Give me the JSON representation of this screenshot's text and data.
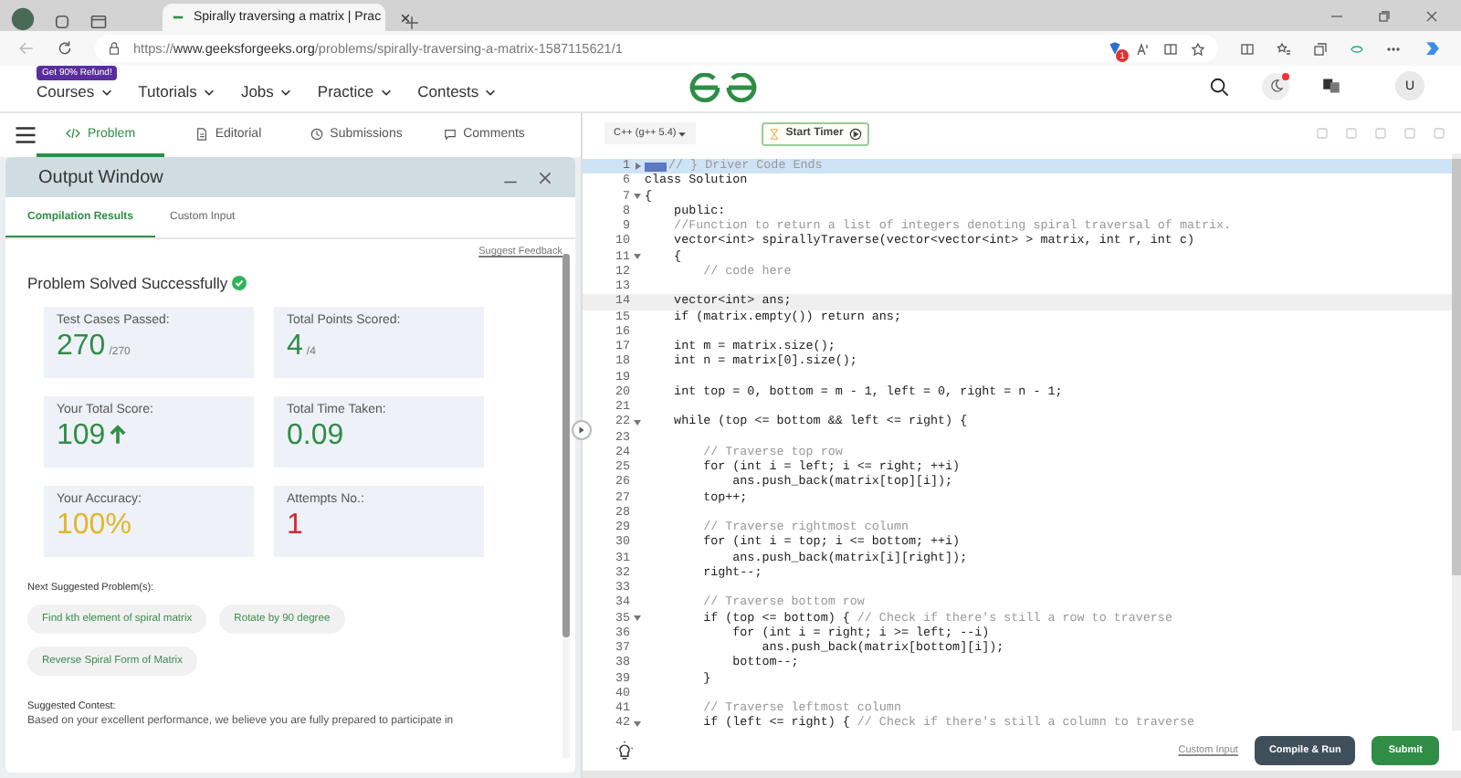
{
  "browser": {
    "tab_title": "Spirally traversing a matrix | Prac",
    "url": "https://**www.geeksforgeeks.org**/problems/spirally-traversing-a-matrix-1587115621/1",
    "extension_badge": "1"
  },
  "site_nav": {
    "promo_badge": "Get 90% Refund!",
    "menus": [
      "Courses",
      "Tutorials",
      "Jobs",
      "Practice",
      "Contests"
    ],
    "notification": true,
    "avatar": "U"
  },
  "problem_tabs": [
    {
      "label": "Problem",
      "selected": true
    },
    {
      "label": "Editorial",
      "selected": false
    },
    {
      "label": "Submissions",
      "selected": false
    },
    {
      "label": "Comments",
      "selected": false
    }
  ],
  "output_window": {
    "title": "Output Window",
    "tabs": [
      {
        "label": "Compilation Results",
        "selected": true
      },
      {
        "label": "Custom Input",
        "selected": false
      }
    ],
    "feedback_link": "Suggest Feedback",
    "status": "Problem Solved Successfully",
    "stats": [
      {
        "label": "Test Cases Passed:",
        "value": "270",
        "suffix": "/270",
        "color": "#2f8d46"
      },
      {
        "label": "Total Points Scored:",
        "value": "4",
        "suffix": "/4",
        "color": "#2f8d46"
      },
      {
        "label": "Your Total Score:",
        "value": "109",
        "trend_up": true,
        "color": "#2f8d46"
      },
      {
        "label": "Total Time Taken:",
        "value": "0.09",
        "color": "#2f8d46"
      },
      {
        "label": "Your Accuracy:",
        "value": "100%",
        "color": "#e3b52c"
      },
      {
        "label": "Attempts No.:",
        "value": "1",
        "color": "#d12a35"
      }
    ],
    "suggested_heading": "Next Suggested Problem(s):",
    "suggested_problems": [
      "Find kth element of spiral matrix",
      "Rotate by 90 degree",
      "Reverse Spiral Form of Matrix"
    ],
    "contest_heading": "Suggested Contest:",
    "contest_text": "Based on your excellent performance, we believe you are fully prepared to participate in"
  },
  "editor": {
    "language": "C++ (g++ 5.4)",
    "timer_button": "Start Timer",
    "custom_input_link": "Custom Input",
    "buttons": [
      {
        "label": "Compile & Run",
        "kind": "secondary"
      },
      {
        "label": "Submit",
        "kind": "primary"
      }
    ],
    "lines": [
      {
        "number": "1",
        "collapsed": true,
        "highlighted": true,
        "comment": "// } Driver Code Ends"
      },
      {
        "number": "6",
        "code": "class Solution"
      },
      {
        "number": "7",
        "foldable": true,
        "code": "{"
      },
      {
        "number": "8",
        "code": "    public:"
      },
      {
        "number": "9",
        "comment": "    //Function to return a list of integers denoting spiral traversal of matrix."
      },
      {
        "number": "10",
        "code": "    vector<int> spirallyTraverse(vector<vector<int> > matrix, int r, int c)"
      },
      {
        "number": "11",
        "foldable": true,
        "code": "    {"
      },
      {
        "number": "12",
        "comment": "        // code here"
      },
      {
        "number": "13"
      },
      {
        "number": "14",
        "current": true,
        "code": "    vector<int> ans;"
      },
      {
        "number": "15",
        "code": "    if (matrix.empty()) return ans;"
      },
      {
        "number": "16"
      },
      {
        "number": "17",
        "code": "    int m = matrix.size();"
      },
      {
        "number": "18",
        "code": "    int n = matrix[0].size();"
      },
      {
        "number": "19"
      },
      {
        "number": "20",
        "code": "    int top = 0, bottom = m - 1, left = 0, right = n - 1;"
      },
      {
        "number": "21"
      },
      {
        "number": "22",
        "foldable": true,
        "code": "    while (top <= bottom && left <= right) {"
      },
      {
        "number": "23"
      },
      {
        "number": "24",
        "comment": "        // Traverse top row"
      },
      {
        "number": "25",
        "code": "        for (int i = left; i <= right; ++i)"
      },
      {
        "number": "26",
        "code": "            ans.push_back(matrix[top][i]);"
      },
      {
        "number": "27",
        "code": "        top++;"
      },
      {
        "number": "28"
      },
      {
        "number": "29",
        "comment": "        // Traverse rightmost column"
      },
      {
        "number": "30",
        "code": "        for (int i = top; i <= bottom; ++i)"
      },
      {
        "number": "31",
        "code": "            ans.push_back(matrix[i][right]);"
      },
      {
        "number": "32",
        "code": "        right--;"
      },
      {
        "number": "33"
      },
      {
        "number": "34",
        "comment": "        // Traverse bottom row"
      },
      {
        "number": "35",
        "foldable": true,
        "code": "        if (top <= bottom) { ",
        "comment": "// Check if there's still a row to traverse"
      },
      {
        "number": "36",
        "code": "            for (int i = right; i >= left; --i)"
      },
      {
        "number": "37",
        "code": "                ans.push_back(matrix[bottom][i]);"
      },
      {
        "number": "38",
        "code": "            bottom--;"
      },
      {
        "number": "39",
        "code": "        }"
      },
      {
        "number": "40"
      },
      {
        "number": "41",
        "comment": "        // Traverse leftmost column"
      },
      {
        "number": "42",
        "foldable": true,
        "code": "        if (left <= right) { ",
        "comment": "// Check if there's still a column to traverse"
      }
    ]
  }
}
